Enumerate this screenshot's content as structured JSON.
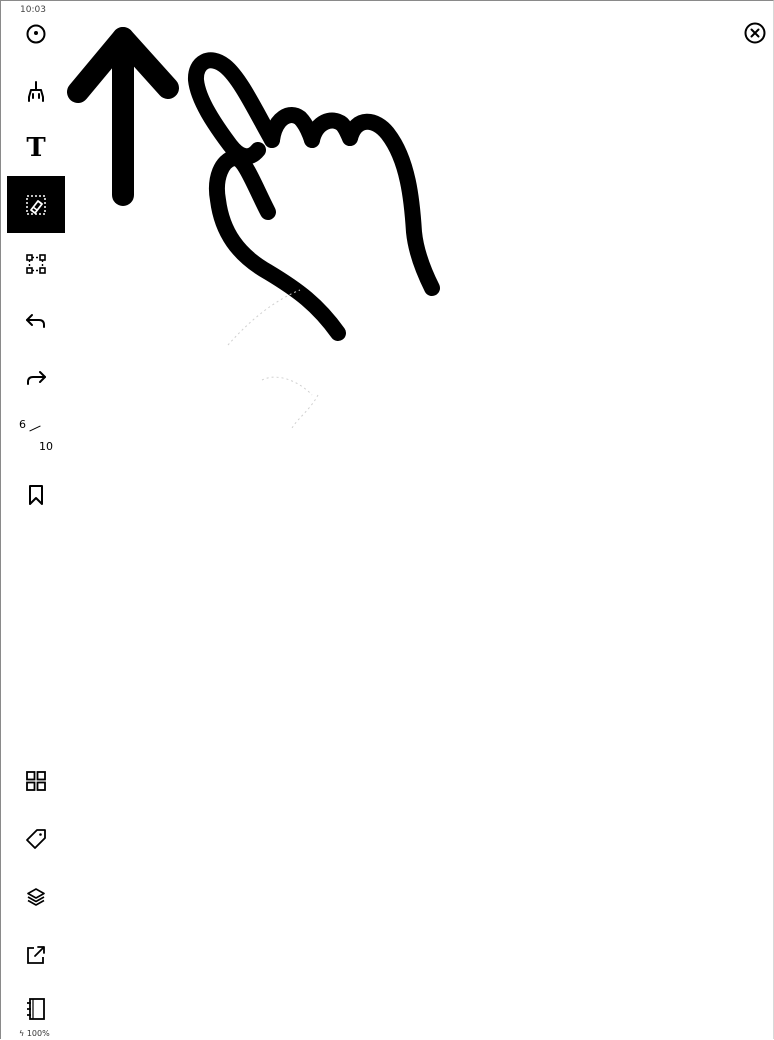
{
  "status": {
    "time": "10:03",
    "battery": "100%"
  },
  "toolbar": {
    "tools": [
      {
        "name": "menu",
        "icon": "circle-dot-icon"
      },
      {
        "name": "pen",
        "icon": "pen-icon"
      },
      {
        "name": "text",
        "icon": "text-icon",
        "glyph": "T"
      },
      {
        "name": "eraser",
        "icon": "eraser-icon",
        "selected": true
      },
      {
        "name": "select",
        "icon": "lasso-select-icon"
      },
      {
        "name": "undo",
        "icon": "undo-icon"
      },
      {
        "name": "redo",
        "icon": "redo-icon"
      }
    ],
    "page": {
      "current": "6",
      "total": "10"
    },
    "bookmark": "bookmark-icon",
    "bottom_tools": [
      {
        "name": "pages",
        "icon": "grid-icon"
      },
      {
        "name": "tags",
        "icon": "tag-icon"
      },
      {
        "name": "layers",
        "icon": "layers-icon"
      },
      {
        "name": "share",
        "icon": "share-icon"
      },
      {
        "name": "notebook",
        "icon": "notebook-icon"
      }
    ]
  },
  "close_icon": "close-icon",
  "canvas": {
    "drawing": "swipe-up-gesture-illustration"
  },
  "colors": {
    "ink": "#000000",
    "background": "#ffffff",
    "selected_tool_bg": "#000000",
    "ghost_stroke": "#d0d0d0"
  }
}
